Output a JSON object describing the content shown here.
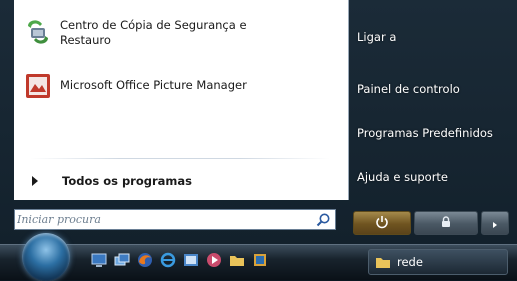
{
  "start_menu": {
    "programs": [
      {
        "label_line1": "Centro de Cópia de Segurança e",
        "label_line2": "Restauro",
        "icon": "backup-restore-icon"
      },
      {
        "label_line1": "Microsoft Office Picture Manager",
        "icon": "picture-manager-icon"
      }
    ],
    "all_programs": {
      "label": "Todos os programas",
      "icon": "right-arrow-icon"
    },
    "search": {
      "placeholder": "Iniciar procura",
      "icon": "search-icon"
    },
    "right_pane": [
      {
        "label": "Ligar a"
      },
      {
        "label": "Painel de controlo"
      },
      {
        "label": "Programas Predefinidos"
      },
      {
        "label": "Ajuda e suporte"
      }
    ],
    "power": {
      "power_icon": "power-icon",
      "lock_icon": "lock-icon",
      "arrow_icon": "arrow-right-icon"
    }
  },
  "taskbar": {
    "start_button": {
      "icon": "windows-orb-icon"
    },
    "quick_launch": [
      {
        "icon": "show-desktop-icon"
      },
      {
        "icon": "switch-windows-icon"
      },
      {
        "icon": "firefox-icon"
      },
      {
        "icon": "internet-explorer-icon"
      },
      {
        "icon": "explorer-icon"
      },
      {
        "icon": "media-icon"
      },
      {
        "icon": "folder-icon"
      },
      {
        "icon": "app-icon"
      }
    ],
    "active_task": {
      "label": "rede",
      "icon": "folder-icon"
    }
  }
}
